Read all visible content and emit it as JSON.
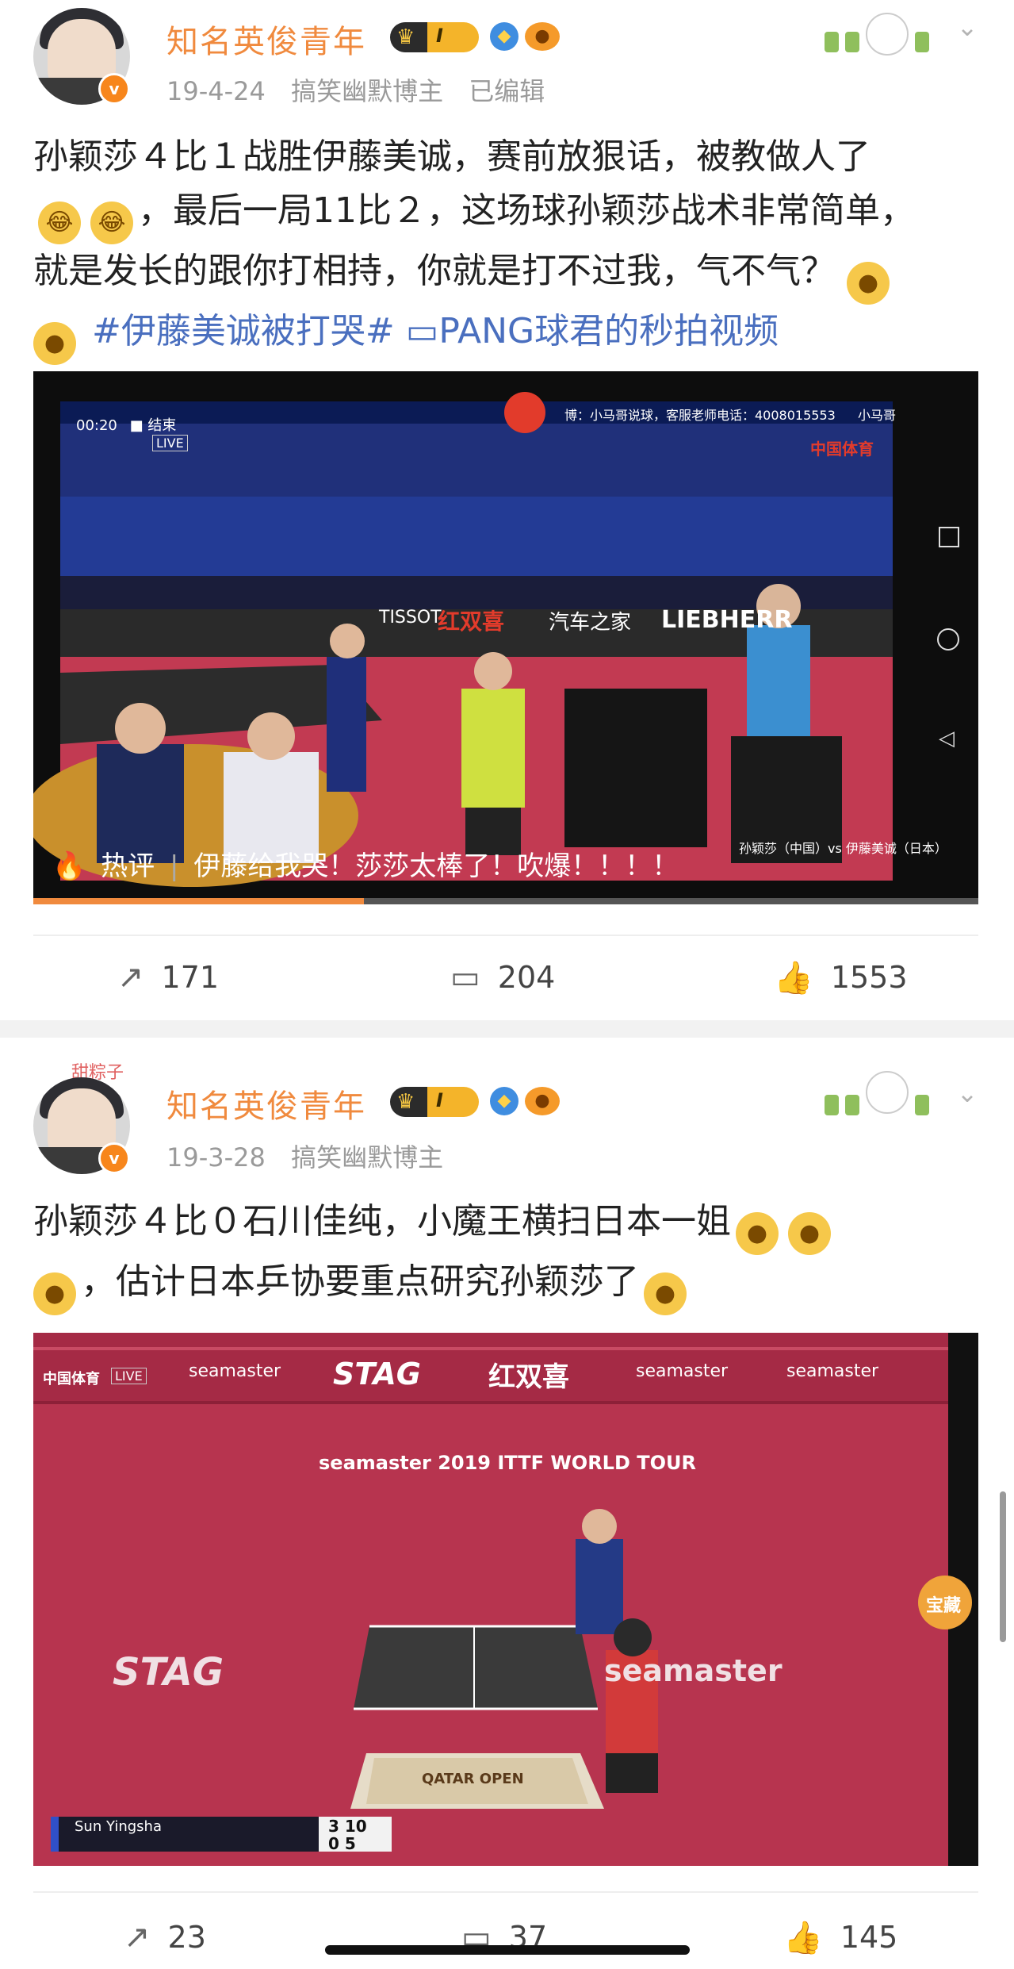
{
  "posts": [
    {
      "username": "知名英俊青年",
      "level": "I",
      "date": "19-4-24",
      "tag": "搞笑幽默博主",
      "edited": "已编辑",
      "text_line1": "孙颖莎４比１战胜伊藤美诚，赛前放狠话，被教做人了",
      "text_line2_rest": "，最后一局11比２，这场球孙颖莎战术非常简单，",
      "text_line3": "就是发长的跟你打相持，你就是打不过我，气不气？",
      "hashtag": "#伊藤美诚被打哭#",
      "video_link": "PANG球君的秒拍视频",
      "video": {
        "time": "00:20",
        "status": "结束",
        "live": "LIVE",
        "ticker": "博：小马哥说球，客服老师电话：4008015553",
        "ticker_right": "小马哥",
        "channel": "中国体育",
        "board1": "TISSOT",
        "board2": "红双喜",
        "board3": "汽车之家",
        "board4": "LIEBHERR",
        "caption": "孙颖莎（中国）vs 伊藤美诚（日本）",
        "hot_label": "热评",
        "hot_comment": "伊藤给我哭！莎莎太棒了！吹爆！！！！"
      },
      "reposts": "171",
      "comments": "204",
      "likes": "1553"
    },
    {
      "username": "知名英俊青年",
      "level": "I",
      "date": "19-3-28",
      "tag": "搞笑幽默博主",
      "text_line1": "孙颖莎４比０石川佳纯，小魔王横扫日本一姐",
      "text_line2_rest": "，估计日本乒协要重点研究孙颖莎了",
      "avatar_tag": "甜粽子",
      "video": {
        "channel": "中国体育",
        "live": "LIVE",
        "board1": "seamaster",
        "board2": "STAG",
        "board3": "红双喜",
        "court_text": "seamaster 2019 ITTF WORLD TOUR",
        "table_text": "QATAR OPEN",
        "floor_left": "STAG",
        "floor_right": "seamaster",
        "player": "Sun Yingsha",
        "score_top": "3",
        "score_top2": "10",
        "score_bottom": "0",
        "score_bottom2": "5",
        "badge": "宝藏"
      },
      "reposts": "23",
      "comments": "37",
      "likes": "145"
    }
  ],
  "icons": {
    "repost": "share-icon",
    "comment": "comment-icon",
    "like": "thumbs-up-icon",
    "hot": "fire-icon"
  },
  "colors": {
    "username": "#f08a3e",
    "topic": "#4a6fbf",
    "progress": "#f08a3e"
  },
  "video1_progress": 0.35
}
